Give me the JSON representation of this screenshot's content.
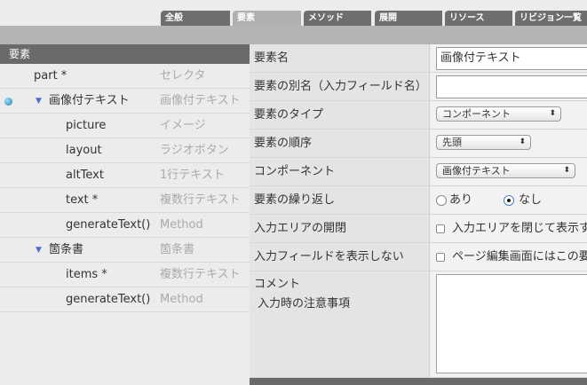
{
  "tabs": [
    {
      "label": "全般",
      "active": false
    },
    {
      "label": "要素",
      "active": true
    },
    {
      "label": "メソッド",
      "active": false
    },
    {
      "label": "展開",
      "active": false
    },
    {
      "label": "リソース",
      "active": false
    },
    {
      "label": "リビジョン一覧",
      "active": false
    }
  ],
  "left_panel": {
    "header": "要素",
    "rows": [
      {
        "name": "part *",
        "type": "セレクタ"
      },
      {
        "name": "画像付テキスト",
        "type": "画像付テキスト"
      },
      {
        "name": "picture",
        "type": "イメージ"
      },
      {
        "name": "layout",
        "type": "ラジオボタン"
      },
      {
        "name": "altText",
        "type": "1行テキスト"
      },
      {
        "name": "text *",
        "type": "複数行テキスト"
      },
      {
        "name": "generateText()",
        "type": "Method"
      },
      {
        "name": "箇条書",
        "type": "箇条書"
      },
      {
        "name": "items *",
        "type": "複数行テキスト"
      },
      {
        "name": "generateText()",
        "type": "Method"
      }
    ]
  },
  "form": {
    "element_name": {
      "label": "要素名",
      "value": "画像付テキスト"
    },
    "element_alias": {
      "label": "要素の別名（入力フィールド名）",
      "value": ""
    },
    "element_type": {
      "label": "要素のタイプ",
      "value": "コンポーネント"
    },
    "element_order": {
      "label": "要素の順序",
      "value": "先頭"
    },
    "component": {
      "label": "コンポーネント",
      "value": "画像付テキスト"
    },
    "repeat": {
      "label": "要素の繰り返し",
      "option_yes": "あり",
      "option_no": "なし",
      "selected": "なし"
    },
    "open_area": {
      "label": "入力エリアの開閉",
      "checkbox_label": "入力エリアを閉じて表示す"
    },
    "hide_field": {
      "label": "入力フィールドを表示しない",
      "checkbox_label": "ページ編集画面にはこの要"
    },
    "comment": {
      "label": "コメント",
      "sublabel": "入力時の注意事項",
      "value": ""
    }
  }
}
